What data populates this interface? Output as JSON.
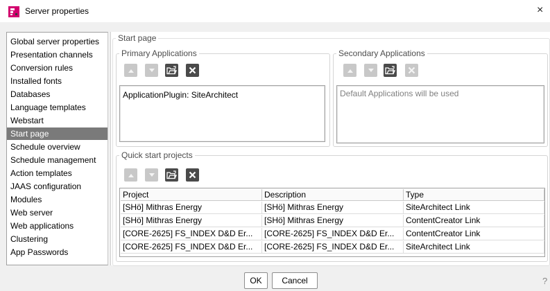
{
  "window": {
    "title": "Server properties",
    "close_glyph": "×"
  },
  "sidebar": {
    "items": [
      "Global server properties",
      "Presentation channels",
      "Conversion rules",
      "Installed fonts",
      "Databases",
      "Language templates",
      "Webstart",
      "Start page",
      "Schedule overview",
      "Schedule management",
      "Action templates",
      "JAAS configuration",
      "Modules",
      "Web server",
      "Web applications",
      "Clustering",
      "App Passwords"
    ],
    "selected": "Start page"
  },
  "start_page": {
    "legend": "Start page",
    "primary": {
      "legend": "Primary Applications",
      "entries": [
        "ApplicationPlugin: SiteArchitect"
      ]
    },
    "secondary": {
      "legend": "Secondary Applications",
      "placeholder": "Default Applications will be used"
    },
    "quick_start": {
      "legend": "Quick start projects",
      "columns": [
        "Project",
        "Description",
        "Type"
      ],
      "rows": [
        [
          "[SHö] Mithras Energy",
          "[SHö] Mithras Energy",
          "SiteArchitect Link"
        ],
        [
          "[SHö] Mithras Energy",
          "[SHö] Mithras Energy",
          "ContentCreator Link"
        ],
        [
          "[CORE-2625] FS_INDEX D&D Er...",
          "[CORE-2625] FS_INDEX D&D Er...",
          "ContentCreator Link"
        ],
        [
          "[CORE-2625] FS_INDEX D&D Er...",
          "[CORE-2625] FS_INDEX D&D Er...",
          "SiteArchitect Link"
        ]
      ]
    }
  },
  "toolbar_icons": [
    "move-up-icon",
    "move-down-icon",
    "browse-folder-icon",
    "remove-icon"
  ],
  "footer": {
    "ok_label": "OK",
    "cancel_label": "Cancel",
    "help_glyph": "?"
  },
  "colors": {
    "selected_bg": "#7a7a7a",
    "app_icon": "#d2006e"
  }
}
